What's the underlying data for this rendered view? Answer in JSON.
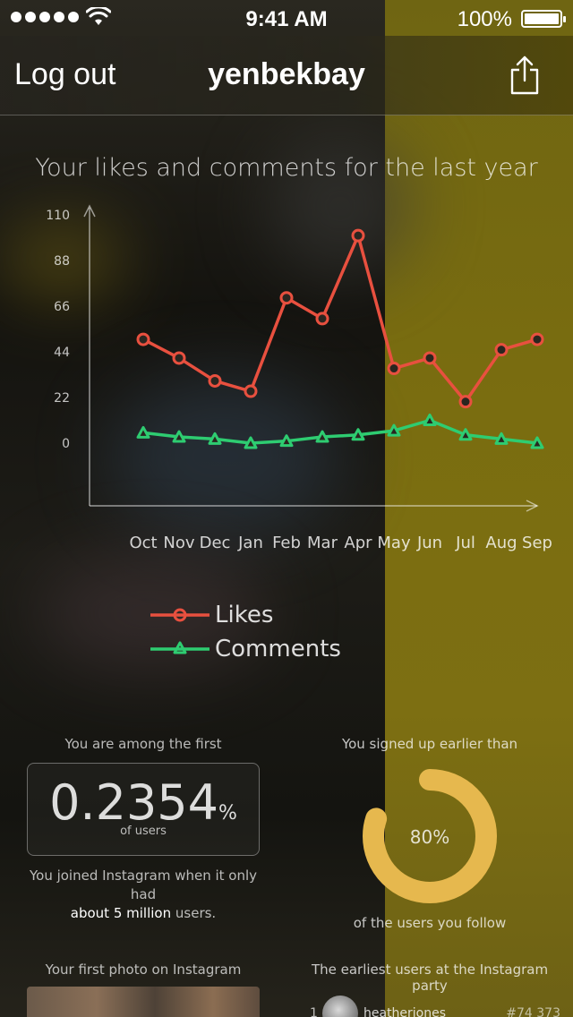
{
  "status_bar": {
    "signal_dots": 5,
    "wifi_icon": "wifi-icon",
    "time": "9:41 AM",
    "battery_percent": "100%",
    "battery_level": 1.0
  },
  "nav": {
    "logout_label": "Log out",
    "title": "yenbekbay",
    "share_icon": "share-icon"
  },
  "chart_title": "Your likes and comments for the last year",
  "chart_data": {
    "type": "line",
    "title": "Your likes and comments for the last year",
    "categories": [
      "Oct",
      "Nov",
      "Dec",
      "Jan",
      "Feb",
      "Mar",
      "Apr",
      "May",
      "Jun",
      "Jul",
      "Aug",
      "Sep"
    ],
    "y_ticks": [
      "110",
      "88",
      "66",
      "44",
      "22",
      "0"
    ],
    "ylim": [
      0,
      110
    ],
    "grid": false,
    "legend_position": "bottom-left",
    "series": [
      {
        "name": "Likes",
        "color": "#e8503f",
        "marker": "circle",
        "values": [
          50,
          41,
          30,
          25,
          70,
          60,
          100,
          36,
          41,
          20,
          45,
          50
        ]
      },
      {
        "name": "Comments",
        "color": "#2ecc71",
        "marker": "triangle",
        "values": [
          5,
          3,
          2,
          0,
          1,
          3,
          4,
          6,
          11,
          4,
          2,
          0
        ]
      }
    ]
  },
  "legend": {
    "likes": "Likes",
    "comments": "Comments"
  },
  "stats": {
    "first_caption": "You are among the first",
    "first_value": "0.2354",
    "first_unit": "%",
    "first_sub": "of users",
    "first_note_prefix": "You joined Instagram when it only had",
    "first_note_bold": "about 5 million",
    "first_note_suffix": "users.",
    "signup_caption": "You signed up earlier than",
    "signup_percent_label": "80%",
    "signup_fraction": 0.8,
    "signup_color": "#e6b84e",
    "signup_under": "of the users you follow"
  },
  "bottom": {
    "first_photo_caption": "Your first photo on Instagram",
    "earliest_caption": "The earliest users at the Instagram party",
    "earliest_users": [
      {
        "rank": "1",
        "username": "heatherjones",
        "id": "#74 373"
      }
    ]
  }
}
